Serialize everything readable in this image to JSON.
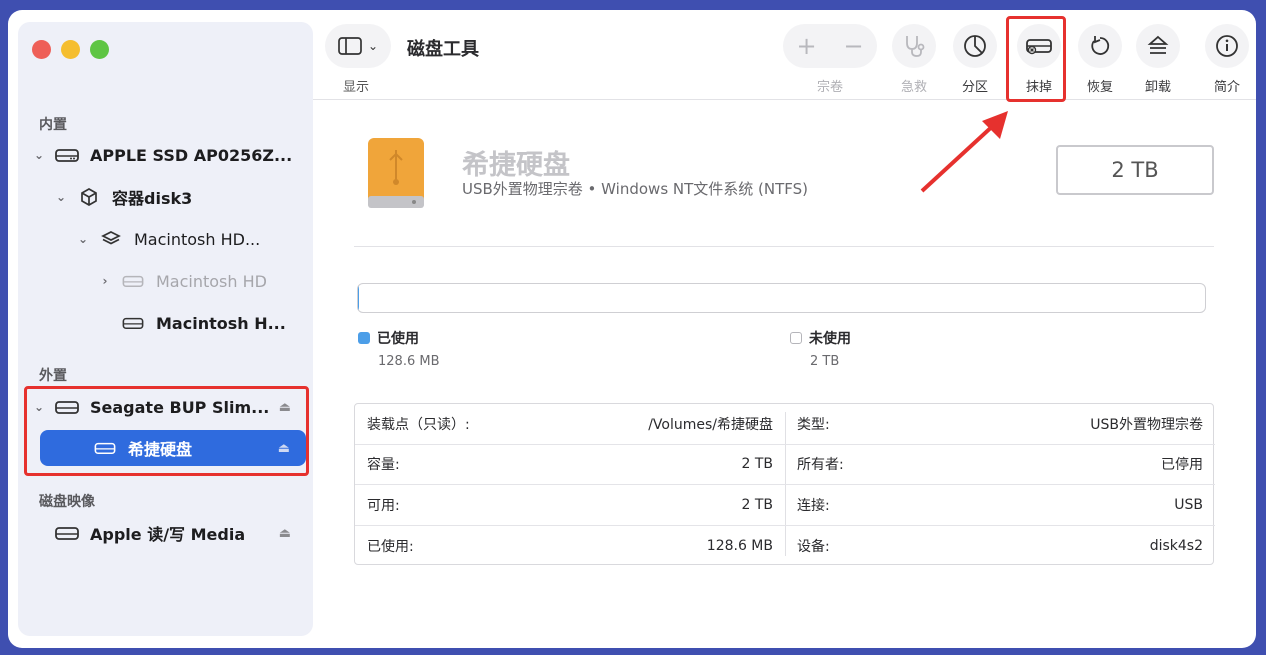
{
  "sidebar": {
    "sections": {
      "internal": "内置",
      "external": "外置",
      "images": "磁盘映像"
    },
    "items": [
      {
        "label": "APPLE SSD AP0256Z...",
        "icon": "drive-icon"
      },
      {
        "label": "容器disk3",
        "icon": "container-icon"
      },
      {
        "label": "Macintosh HD...",
        "icon": "volume-stack-icon"
      },
      {
        "label": "Macintosh HD",
        "icon": "drive-icon"
      },
      {
        "label": "Macintosh H...",
        "icon": "drive-icon"
      },
      {
        "label": "Seagate BUP Slim...",
        "icon": "drive-icon"
      },
      {
        "label": "希捷硬盘",
        "icon": "drive-icon"
      },
      {
        "label": "Apple 读/写 Media",
        "icon": "drive-icon"
      }
    ]
  },
  "toolbar": {
    "view_label": "显示",
    "title": "磁盘工具",
    "buttons": [
      {
        "label": "宗卷",
        "enabled": false
      },
      {
        "label": "急救",
        "enabled": false
      },
      {
        "label": "分区",
        "enabled": true
      },
      {
        "label": "抹掉",
        "enabled": true
      },
      {
        "label": "恢复",
        "enabled": true
      },
      {
        "label": "卸载",
        "enabled": true
      },
      {
        "label": "简介",
        "enabled": true
      }
    ]
  },
  "disk": {
    "name": "希捷硬盘",
    "description": "USB外置物理宗卷 • Windows NT文件系统 (NTFS)",
    "size": "2 TB",
    "used_fraction": 0.0001
  },
  "legend": {
    "used_label": "已使用",
    "used_value": "128.6 MB",
    "used_color": "#4c9ee8",
    "free_label": "未使用",
    "free_value": "2 TB"
  },
  "info": {
    "left": [
      {
        "key": "装载点（只读）:",
        "value": "/Volumes/希捷硬盘"
      },
      {
        "key": "容量:",
        "value": "2 TB"
      },
      {
        "key": "可用:",
        "value": "2 TB"
      },
      {
        "key": "已使用:",
        "value": "128.6 MB"
      }
    ],
    "right": [
      {
        "key": "类型:",
        "value": "USB外置物理宗卷"
      },
      {
        "key": "所有者:",
        "value": "已停用"
      },
      {
        "key": "连接:",
        "value": "USB"
      },
      {
        "key": "设备:",
        "value": "disk4s2"
      }
    ]
  },
  "colors": {
    "accent": "#2f6bde",
    "highlight": "#e6312e"
  }
}
